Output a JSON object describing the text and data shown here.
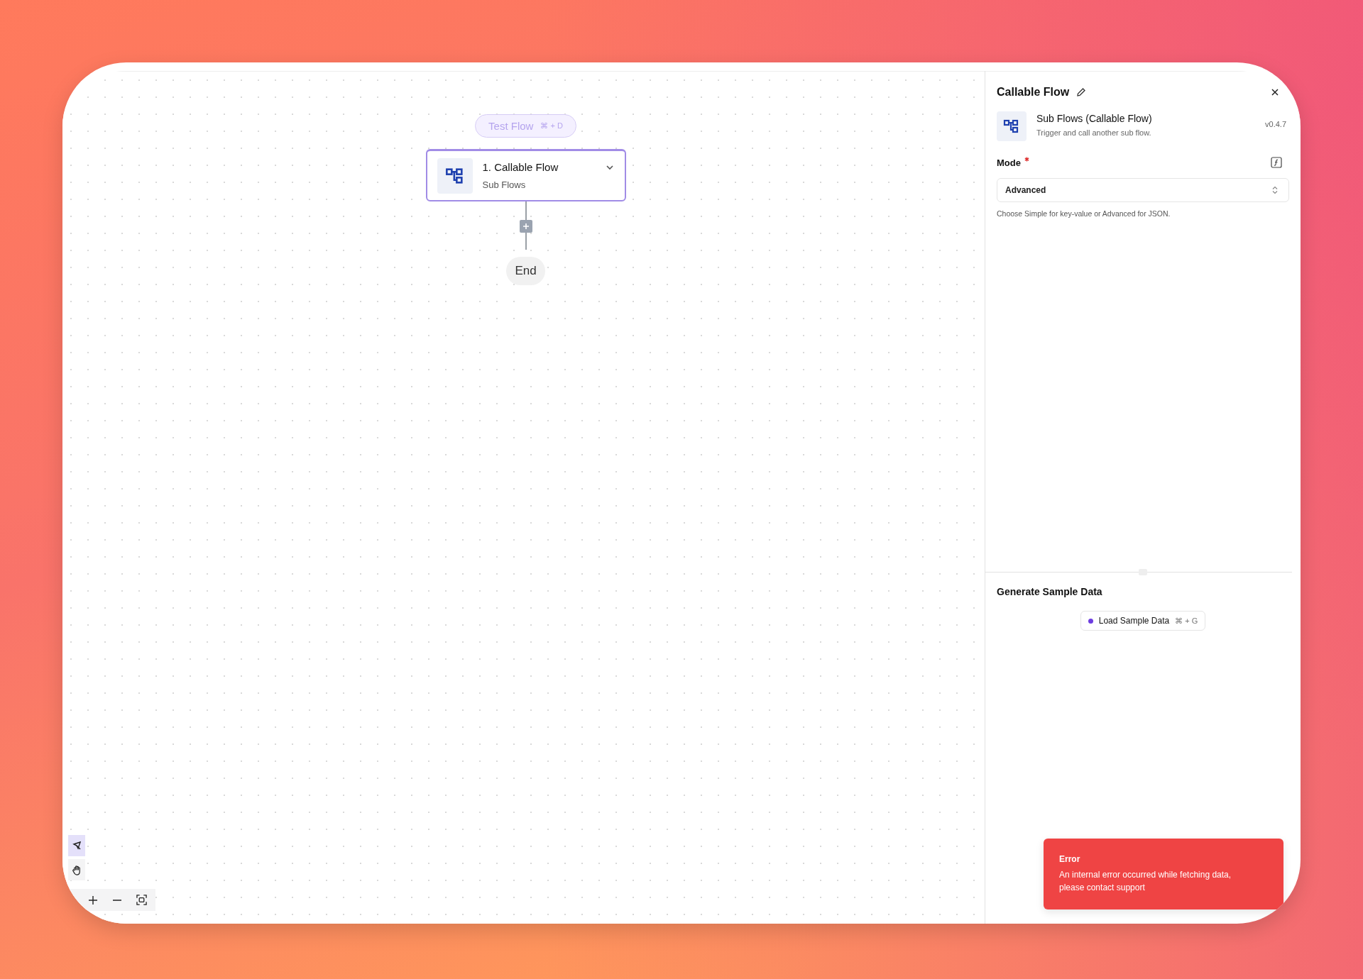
{
  "flow": {
    "test_button": {
      "label": "Test Flow",
      "shortcut": "⌘ + D"
    },
    "steps": [
      {
        "title": "1. Callable Flow",
        "subtitle": "Sub Flows",
        "selected": true
      }
    ],
    "end_label": "End"
  },
  "canvas_tools": [
    {
      "kind": "select",
      "selected": true
    },
    {
      "kind": "pan",
      "selected": false
    }
  ],
  "panel": {
    "title": "Callable Flow",
    "piece": {
      "name": "Sub Flows (Callable Flow)",
      "description": "Trigger and call another sub flow.",
      "version": "v0.4.7"
    },
    "fields": [
      {
        "label": "Mode",
        "required": true,
        "value": "Advanced",
        "help": "Choose Simple for key-value or Advanced for JSON."
      }
    ],
    "sample_data": {
      "title": "Generate Sample Data",
      "button": {
        "label": "Load Sample Data",
        "shortcut": "⌘ + G"
      }
    }
  },
  "toast": {
    "title": "Error",
    "message": "An internal error occurred while fetching data, please contact support"
  }
}
